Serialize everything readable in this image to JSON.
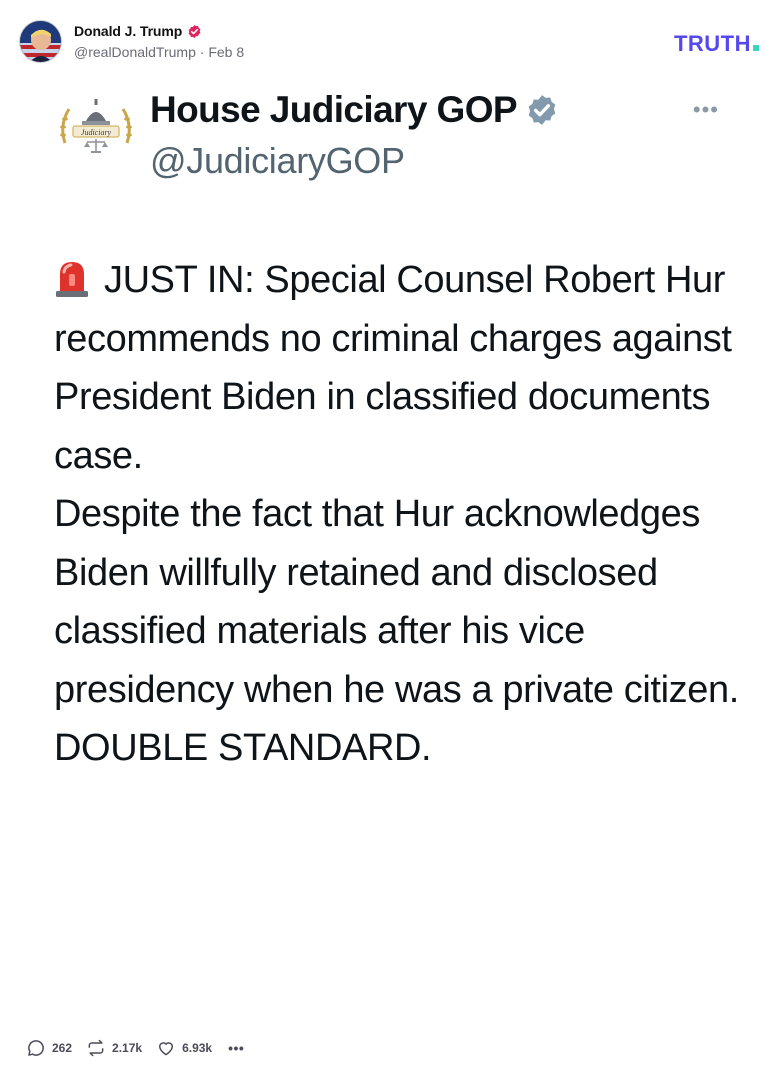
{
  "post": {
    "author_name": "Donald J. Trump",
    "handle": "@realDonaldTrump",
    "separator": "·",
    "date": "Feb 8"
  },
  "brand": {
    "logo_text": "TRUTH",
    "logo_color": "#5448ee",
    "logo_dot_color": "#36d6c3"
  },
  "embedded_tweet": {
    "display_name": "House Judiciary GOP",
    "handle": "@JudiciaryGOP",
    "more_label": "•••",
    "seal_text": "Judiciary",
    "paragraphs": [
      "JUST IN: Special Counsel Robert Hur recommends no criminal charges against President Biden in classified documents case.",
      "Despite the fact that Hur acknowledges Biden willfully retained and disclosed classified materials after his vice presidency when he was a private citizen.",
      "DOUBLE STANDARD."
    ]
  },
  "actions": {
    "replies": "262",
    "retruths": "2.17k",
    "likes": "6.93k",
    "more": "•••"
  },
  "icons": {
    "author_verified": "verified-badge-icon",
    "tweet_verified": "verified-badge-icon",
    "siren": "police-siren-icon",
    "reply": "comment-icon",
    "retruth": "repost-icon",
    "like": "heart-icon",
    "more": "more-dots-icon"
  },
  "colors": {
    "verified_badge": "#e0245e",
    "tweet_verified_badge": "#829aab",
    "handle_gray": "#536471",
    "siren_red": "#e0322c"
  }
}
